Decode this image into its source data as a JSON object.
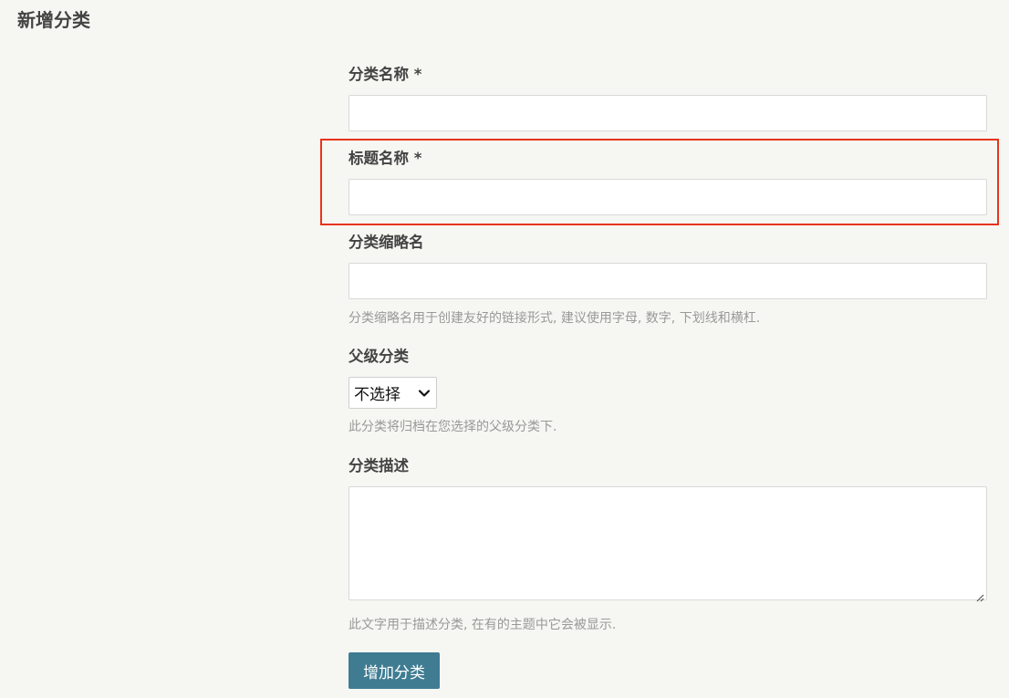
{
  "page": {
    "title": "新增分类"
  },
  "form": {
    "category_name": {
      "label": "分类名称 *",
      "value": "",
      "placeholder": ""
    },
    "title_name": {
      "label": "标题名称 *",
      "value": "",
      "placeholder": ""
    },
    "slug": {
      "label": "分类缩略名",
      "value": "",
      "placeholder": "",
      "help": "分类缩略名用于创建友好的链接形式, 建议使用字母, 数字, 下划线和横杠."
    },
    "parent": {
      "label": "父级分类",
      "selected": "不选择",
      "help": "此分类将归档在您选择的父级分类下."
    },
    "description": {
      "label": "分类描述",
      "value": "",
      "help": "此文字用于描述分类, 在有的主题中它会被显示."
    },
    "submit_label": "增加分类"
  },
  "colors": {
    "background": "#f6f6f2",
    "accent": "#3f7c92",
    "highlight": "#e8341c",
    "label": "#444444",
    "help": "#999999"
  },
  "icons": {
    "select_chevron": "chevron-down-icon",
    "textarea_resize": "resize-handle-icon"
  }
}
